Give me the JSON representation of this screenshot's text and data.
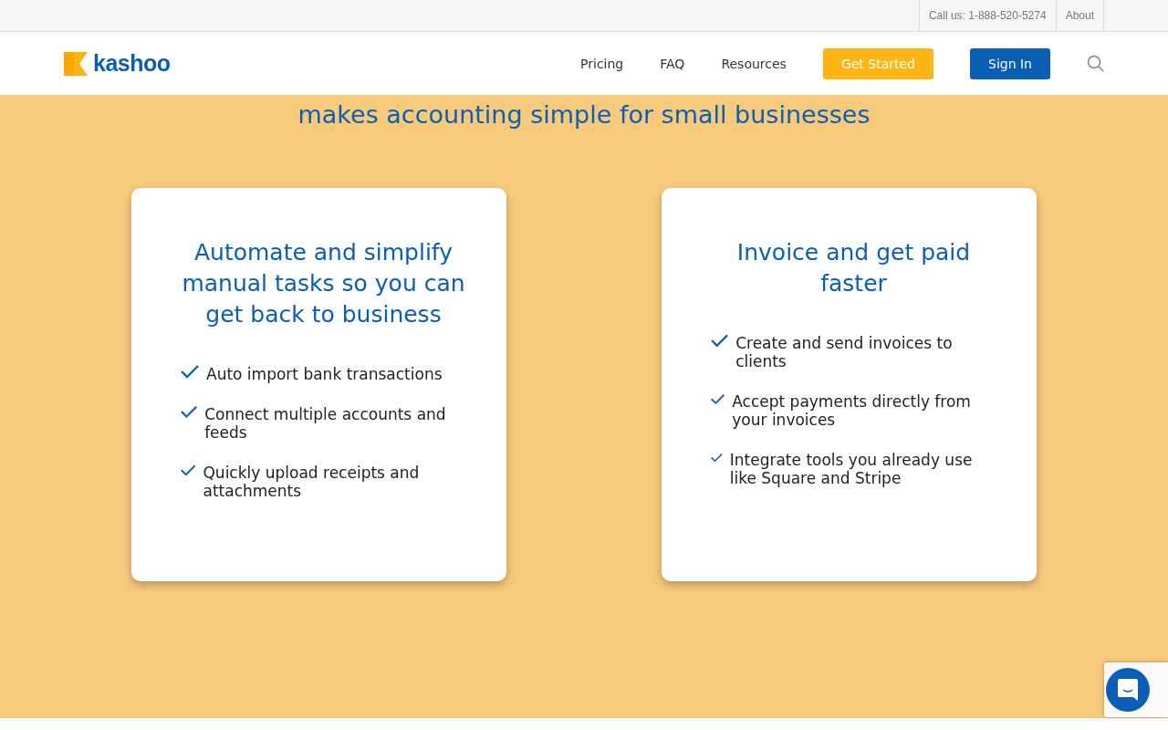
{
  "top_bar": {
    "links": [
      "Call us: 1-888-520-5274",
      "About"
    ]
  },
  "header": {
    "logo": "kashoo",
    "nav": [
      "Pricing",
      "FAQ",
      "Resources"
    ],
    "buttons": [
      {
        "label": "Get Started",
        "kind": "primary"
      },
      {
        "label": "Sign In",
        "kind": "secondary"
      }
    ]
  },
  "headline": "makes accounting simple for small businesses",
  "cards": [
    {
      "title": "Automate and simplify manual tasks so you can get back to business",
      "items": [
        "Auto import bank transactions",
        "Connect multiple accounts and feeds",
        "Quickly upload receipts and attachments"
      ]
    },
    {
      "title": "Invoice and get paid faster",
      "items": [
        "Create and send invoices to clients",
        "Accept payments directly from your invoices",
        "Integrate tools you already use like Square and Stripe"
      ]
    }
  ]
}
